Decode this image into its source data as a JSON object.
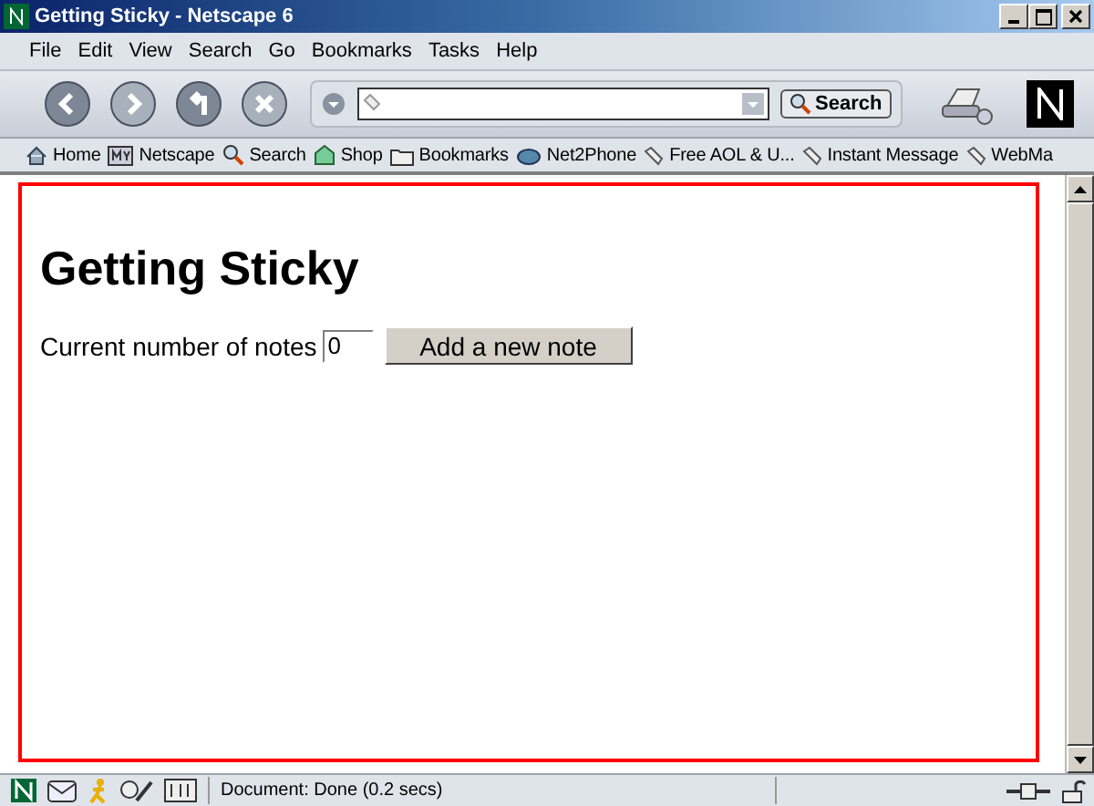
{
  "window": {
    "title": "Getting Sticky - Netscape 6"
  },
  "menu": [
    "File",
    "Edit",
    "View",
    "Search",
    "Go",
    "Bookmarks",
    "Tasks",
    "Help"
  ],
  "search_button": "Search",
  "bookmarks": [
    {
      "label": "Home",
      "kind": "home"
    },
    {
      "label": "Netscape",
      "kind": "my"
    },
    {
      "label": "Search",
      "kind": "search"
    },
    {
      "label": "Shop",
      "kind": "shop"
    },
    {
      "label": "Bookmarks",
      "kind": "folder"
    },
    {
      "label": "Net2Phone",
      "kind": "phone"
    },
    {
      "label": "Free AOL & U...",
      "kind": "link"
    },
    {
      "label": "Instant Message",
      "kind": "link"
    },
    {
      "label": "WebMa",
      "kind": "link"
    }
  ],
  "page": {
    "heading": "Getting Sticky",
    "notes_label": "Current number of notes",
    "notes_value": "0",
    "add_button": "Add a new note"
  },
  "status_bar": {
    "text": "Document: Done (0.2 secs)"
  }
}
